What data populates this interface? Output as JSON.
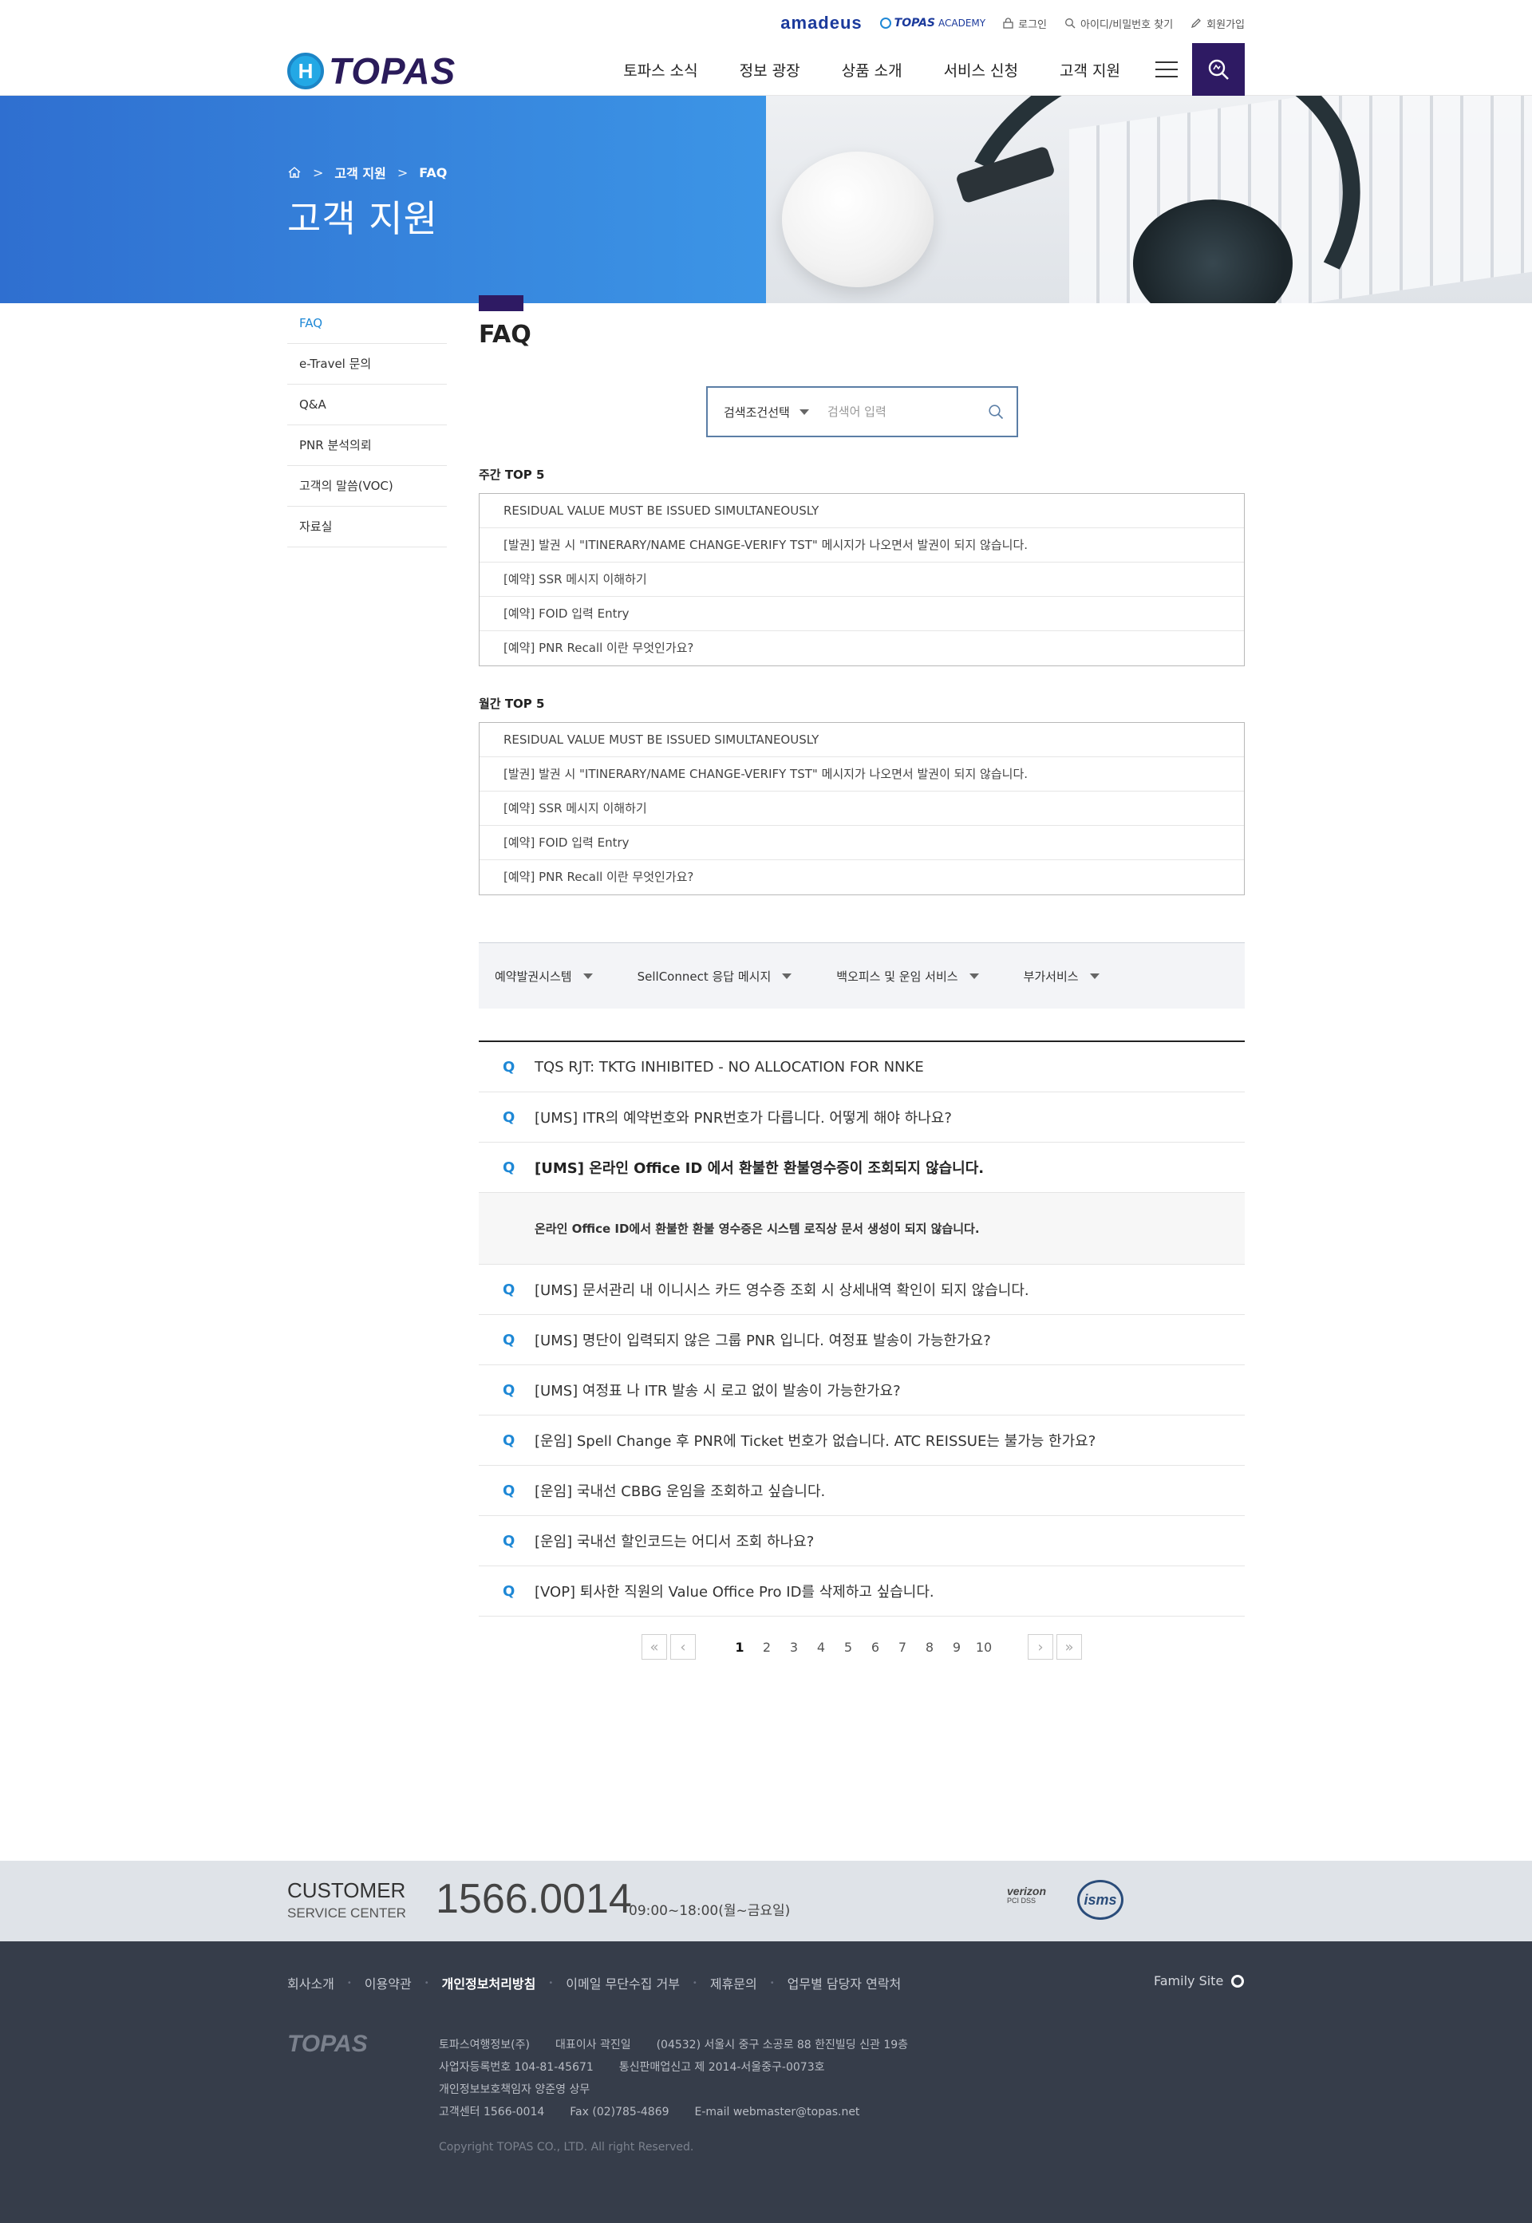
{
  "util": {
    "amadeus": "amadeus",
    "academy_brand": "TOPAS",
    "academy_suffix": "ACADEMY",
    "login": "로그인",
    "find": "아이디/비밀번호 찾기",
    "join": "회원가입"
  },
  "header": {
    "logo_mark": "H",
    "logo_text": "TOPAS",
    "nav": [
      "토파스 소식",
      "정보 광장",
      "상품 소개",
      "서비스 신청",
      "고객 지원"
    ]
  },
  "hero": {
    "breadcrumb": [
      "고객 지원",
      "FAQ"
    ],
    "title": "고객 지원"
  },
  "sidebar": {
    "items": [
      "FAQ",
      "e-Travel 문의",
      "Q&A",
      "PNR 분석의뢰",
      "고객의 말씀(VOC)",
      "자료실"
    ],
    "active": "FAQ"
  },
  "main": {
    "title": "FAQ",
    "search": {
      "select_label": "검색조건선택",
      "placeholder": "검색어 입력"
    },
    "weekly": {
      "label": "주간 TOP 5",
      "items": [
        "RESIDUAL VALUE MUST BE ISSUED SIMULTANEOUSLY",
        "[발권] 발권 시 \"ITINERARY/NAME CHANGE-VERIFY TST\" 메시지가 나오면서 발권이 되지 않습니다.",
        "[예약] SSR 메시지 이해하기",
        "[예약] FOID 입력 Entry",
        "[예약] PNR Recall 이란 무엇인가요?"
      ]
    },
    "monthly": {
      "label": "월간 TOP 5",
      "items": [
        "RESIDUAL VALUE MUST BE ISSUED SIMULTANEOUSLY",
        "[발권] 발권 시 \"ITINERARY/NAME CHANGE-VERIFY TST\" 메시지가 나오면서 발권이 되지 않습니다.",
        "[예약] SSR 메시지 이해하기",
        "[예약] FOID 입력 Entry",
        "[예약] PNR Recall 이란 무엇인가요?"
      ]
    },
    "categories": [
      "예약발권시스템",
      "SellConnect 응답 메시지",
      "백오피스 및 운임 서비스",
      "부가서비스"
    ],
    "faq": {
      "q_mark": "Q",
      "items": [
        "TQS RJT: TKTG INHIBITED - NO ALLOCATION FOR NNKE",
        "[UMS] ITR의 예약번호와 PNR번호가 다릅니다. 어떻게 해야 하나요?",
        "[UMS] 온라인 Office ID 에서 환불한 환불영수증이 조회되지 않습니다.",
        "[UMS] 문서관리 내 이니시스 카드 영수증 조회 시 상세내역 확인이 되지 않습니다.",
        "[UMS] 명단이 입력되지 않은 그룹 PNR 입니다. 여정표 발송이 가능한가요?",
        "[UMS] 여정표 나 ITR 발송 시 로고 없이 발송이 가능한가요?",
        "[운임] Spell Change 후 PNR에 Ticket 번호가 없습니다. ATC REISSUE는 불가능 한가요?",
        "[운임] 국내선 CBBG 운임을 조회하고 싶습니다.",
        "[운임] 국내선 할인코드는 어디서 조회 하나요?",
        "[VOP] 퇴사한 직원의 Value Office Pro ID를 삭제하고 싶습니다."
      ],
      "open_index": 2,
      "answer": "온라인 Office ID에서 환불한 환불 영수증은 시스템 로직상 문서 생성이 되지 않습니다."
    },
    "pager": {
      "pages": [
        "1",
        "2",
        "3",
        "4",
        "5",
        "6",
        "7",
        "8",
        "9",
        "10"
      ],
      "current": "1"
    }
  },
  "customer": {
    "title": "CUSTOMER",
    "subtitle": "SERVICE CENTER",
    "phone": "1566.0014",
    "hours": "09:00~18:00(월~금요일)",
    "badge_verizon": "verizon",
    "badge_verizon_sub": "PCI DSS",
    "badge_isms": "isms"
  },
  "footer": {
    "links": [
      "회사소개",
      "이용약관",
      "개인정보처리방침",
      "이메일 무단수집 거부",
      "제휴문의",
      "업무별 담당자 연락처"
    ],
    "family": "Family Site",
    "logo": "TOPAS",
    "company": "토파스여행정보(주)",
    "ceo": "대표이사 곽진일",
    "address": "(04532) 서울시 중구 소공로 88 한진빌딩 신관 19층",
    "bizno": "사업자등록번호 104-81-45671",
    "ecommerce": "통신판매업신고 제 2014-서울중구-0073호",
    "privacy": "개인정보보호책임자 양준영 상무",
    "cs": "고객센터 1566-0014",
    "fax": "Fax (02)785-4869",
    "email": "E-mail webmaster@topas.net",
    "copyright": "Copyright TOPAS CO., LTD. All right Reserved."
  }
}
